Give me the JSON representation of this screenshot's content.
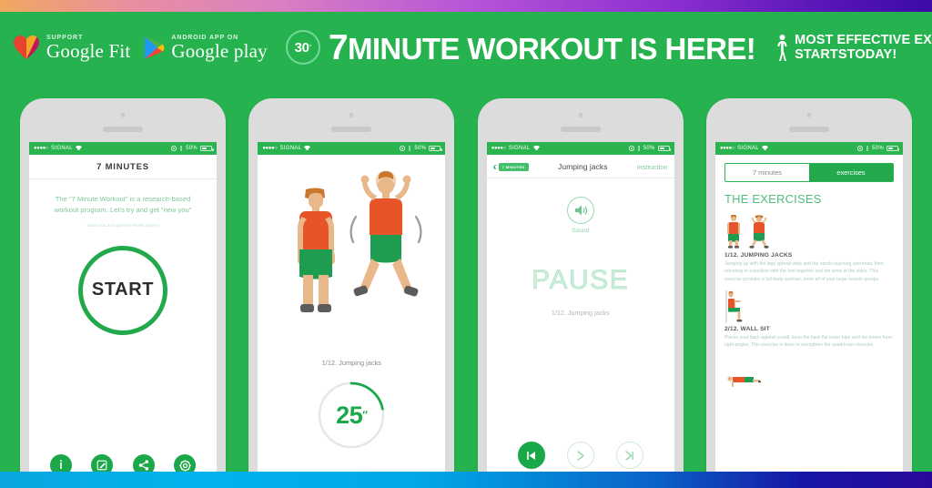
{
  "header": {
    "badges": [
      {
        "sup": "SUPPORT",
        "name": "Google Fit",
        "icon": "heart-icon"
      },
      {
        "sup": "ANDROID APP ON",
        "name": "Google play",
        "icon": "google-play-icon"
      }
    ],
    "ring_number": "30",
    "ring_tick": "\"",
    "headline_seven": "7",
    "headline_rest": "MINUTE WORKOUT IS HERE!",
    "tagline_line1": "MOST EFFECTIVE EXERCISES",
    "tagline_line2": "STARTSTODAY!",
    "runner_icon": "runner-icon"
  },
  "statusbar": {
    "dots": "●●●●○",
    "carrier": "SIGNAL",
    "wifi_icon": "wifi-icon",
    "location_icon": "location-icon",
    "alarm_icon": "alarm-icon",
    "battery_pct": "50%"
  },
  "phone1": {
    "title": "7 MINUTES",
    "body": "The “7 Minute Workout” is a research-based workout program. Let’s try and get “new you”",
    "subtext": "Thank you and open the health journey",
    "start_label": "START",
    "tabs": [
      {
        "label": "Instruction",
        "icon": "info-icon"
      },
      {
        "label": "Log",
        "icon": "edit-icon"
      },
      {
        "label": "Share",
        "icon": "share-icon"
      },
      {
        "label": "Settings",
        "icon": "gear-icon"
      }
    ]
  },
  "phone2": {
    "caption": "1/12. Jumping jacks",
    "timer_value": "25",
    "timer_unit": "″",
    "timer_progress_pct": 22
  },
  "phone3": {
    "back_label": "7 MINUTES",
    "title": "Jumping jacks",
    "instruction_link": "instruction",
    "sound_label": "Sound",
    "state_label": "PAUSE",
    "caption": "1/12. Jumping jacks",
    "controls": [
      {
        "label": "previous",
        "icon": "skip-previous-icon",
        "active": true
      },
      {
        "label": "Continue",
        "icon": "play-arrow-icon",
        "active": false
      },
      {
        "label": "Next",
        "icon": "skip-next-icon",
        "active": false
      }
    ]
  },
  "phone4": {
    "segments": [
      {
        "label": "7 minutes",
        "active": false
      },
      {
        "label": "exercises",
        "active": true
      }
    ],
    "heading": "THE EXERCISES",
    "exercises": [
      {
        "title": "1/12. JUMPING JACKS",
        "description": "Jumping up with the legs spread wide and the hands touching overhead, then returning to a position with the feet together and the arms at the sides. This exercise provides a full-body workout, more all of your large muscle groups."
      },
      {
        "title": "2/12. WALL SIT",
        "description": "Places your back against a wall, keep the back flat lower hips until the knees form right angles. This exercise is done to strengthen the quadriceps muscles."
      }
    ]
  },
  "colors": {
    "brand_green": "#26b34f",
    "dark_green": "#19a847",
    "light_green": "#7fc79a",
    "orange": "#e8542a",
    "phone_body": "#dcdcdc"
  }
}
